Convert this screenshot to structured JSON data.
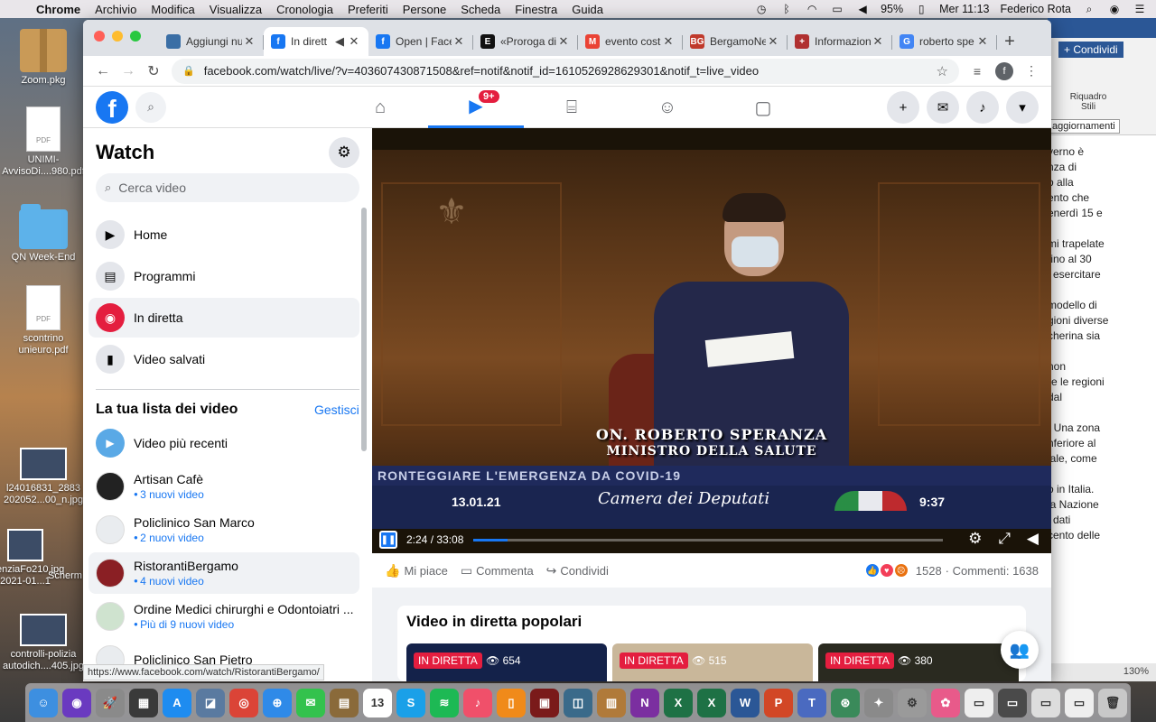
{
  "menubar": {
    "app": "Chrome",
    "items": [
      "Archivio",
      "Modifica",
      "Visualizza",
      "Cronologia",
      "Preferiti",
      "Persone",
      "Scheda",
      "Finestra",
      "Guida"
    ],
    "battery": "95%",
    "datetime": "Mer 11:13",
    "user": "Federico Rota"
  },
  "desktop": {
    "icons": [
      "Zoom.pkg",
      "UNIMI-AvvisoDi....980.pdf",
      "QN Week-End",
      "scontrino unieuro.pdf",
      "controlli-polizia autodich....405.jpg"
    ],
    "partial_labels": [
      "l24016831_2883",
      "202052...00_n.jpg",
      "enziaFo210.jpg",
      "2021-01...1",
      "Scherm"
    ]
  },
  "bg_window": {
    "share_label": "+ Condividi",
    "styles_label": "Riquadro Stili",
    "updates_label": "aggiornamenti",
    "doc_lines": [
      "verno è",
      "nza di",
      "o alla",
      "ento che",
      "enerdì 15 e",
      "",
      "mi trapelate",
      "fino al 30",
      "i esercitare",
      "",
      "modello di",
      "gioni diverse",
      "cherina sia",
      "",
      "non",
      "re le regioni",
      "dal",
      "",
      ". Una zona",
      "nferiore al",
      "iale, come",
      "",
      "o in Italia.",
      "la Nazione",
      "i dati",
      "cento delle"
    ],
    "zoom": "130%"
  },
  "browser": {
    "tabs": [
      {
        "title": "Aggiungi nu",
        "color": "#3a6ea5",
        "letter": "",
        "active": false
      },
      {
        "title": "In dirett",
        "color": "#1877f2",
        "letter": "f",
        "active": true
      },
      {
        "title": "Open | Face",
        "color": "#1877f2",
        "letter": "f",
        "active": false
      },
      {
        "title": "«Proroga di",
        "color": "#111111",
        "letter": "E",
        "active": false
      },
      {
        "title": "evento cost",
        "color": "#ea4335",
        "letter": "M",
        "active": false
      },
      {
        "title": "BergamoNe",
        "color": "#c0392b",
        "letter": "BG",
        "active": false
      },
      {
        "title": "Informazion",
        "color": "#b03030",
        "letter": "+",
        "active": false
      },
      {
        "title": "roberto spe",
        "color": "#4285f4",
        "letter": "G",
        "active": false
      }
    ],
    "url": "facebook.com/watch/live/?v=403607430871508&ref=notif&notif_id=1610526928629301&notif_t=live_video",
    "profile_letter": "f",
    "status_url": "https://www.facebook.com/watch/RistorantiBergamo/"
  },
  "fb": {
    "badge": "9+",
    "watch_title": "Watch",
    "search_placeholder": "Cerca video",
    "menu": [
      "Home",
      "Programmi",
      "In diretta",
      "Video salvati"
    ],
    "list_header": "La tua lista dei video",
    "manage": "Gestisci",
    "list": [
      {
        "name": "Video più recenti",
        "sub": null,
        "color": "#5aa9e6"
      },
      {
        "name": "Artisan Cafè",
        "sub": "3 nuovi video",
        "color": "#222222"
      },
      {
        "name": "Policlinico San Marco",
        "sub": "2 nuovi video",
        "color": "#e9ecef"
      },
      {
        "name": "RistorantiBergamo",
        "sub": "4 nuovi video",
        "color": "#8a1f24"
      },
      {
        "name": "Ordine Medici chirurghi e Odontoiatri ...",
        "sub": "Più di 9 nuovi video",
        "color": "#cfe3cf"
      },
      {
        "name": "Policlinico San Pietro",
        "sub": null,
        "color": "#e9ecef"
      }
    ],
    "video": {
      "caption_name": "ON. ROBERTO SPERANZA",
      "caption_role": "MINISTRO DELLA SALUTE",
      "ticker": "RONTEGGIARE L'EMERGENZA DA COVID-19",
      "date": "13.01.21",
      "channel": "Camera dei Deputati",
      "clock": "9:37",
      "time": "2:24 / 33:08",
      "progress": 0.0725
    },
    "actions": [
      "Mi piace",
      "Commenta",
      "Condividi"
    ],
    "reactions_count": "1528",
    "comments": "· Commenti: 1638",
    "popular_title": "Video in diretta popolari",
    "popular": [
      {
        "live": "IN DIRETTA",
        "viewers": "654",
        "color": "#14224a"
      },
      {
        "live": "IN DIRETTA",
        "viewers": "515",
        "color": "#c9b79a"
      },
      {
        "live": "IN DIRETTA",
        "viewers": "380",
        "color": "#2a2a20"
      }
    ]
  },
  "dock": {
    "apps": [
      {
        "name": "finder-icon",
        "color": "#3d8fe0",
        "glyph": "☺"
      },
      {
        "name": "siri-icon",
        "color": "#6a3ac0",
        "glyph": "◉"
      },
      {
        "name": "launchpad-icon",
        "color": "#8a8a8a",
        "glyph": "🚀"
      },
      {
        "name": "mission-control-icon",
        "color": "#3a3a3a",
        "glyph": "▦"
      },
      {
        "name": "app-store-icon",
        "color": "#1e8cf0",
        "glyph": "A"
      },
      {
        "name": "preview-icon",
        "color": "#5a7aa0",
        "glyph": "◪"
      },
      {
        "name": "chrome-icon",
        "color": "#db4437",
        "glyph": "◎"
      },
      {
        "name": "safari-icon",
        "color": "#2f8ae8",
        "glyph": "⊕"
      },
      {
        "name": "messages-icon",
        "color": "#33c24d",
        "glyph": "✉"
      },
      {
        "name": "notes-icon",
        "color": "#8a6a3a",
        "glyph": "▤"
      },
      {
        "name": "calendar-icon",
        "color": "#ffffff",
        "glyph": "13"
      },
      {
        "name": "skype-icon",
        "color": "#1aa0e8",
        "glyph": "S"
      },
      {
        "name": "spotify-icon",
        "color": "#1db954",
        "glyph": "≋"
      },
      {
        "name": "music-icon",
        "color": "#f0506a",
        "glyph": "♪"
      },
      {
        "name": "books-icon",
        "color": "#f08a1a",
        "glyph": "▯"
      },
      {
        "name": "photo-booth-icon",
        "color": "#7a1a1a",
        "glyph": "▣"
      },
      {
        "name": "image-capture-icon",
        "color": "#3a6a8a",
        "glyph": "◫"
      },
      {
        "name": "photos-folder-icon",
        "color": "#b07a3a",
        "glyph": "▥"
      },
      {
        "name": "onenote-icon",
        "color": "#7b2fa0",
        "glyph": "N"
      },
      {
        "name": "excel-icon",
        "color": "#1e7145",
        "glyph": "X"
      },
      {
        "name": "excel-icon-2",
        "color": "#1e7145",
        "glyph": "X"
      },
      {
        "name": "word-icon",
        "color": "#2b5796",
        "glyph": "W"
      },
      {
        "name": "powerpoint-icon",
        "color": "#d24726",
        "glyph": "P"
      },
      {
        "name": "teams-icon",
        "color": "#4a6ac0",
        "glyph": "T"
      },
      {
        "name": "network-icon",
        "color": "#3a8a5a",
        "glyph": "⊛"
      },
      {
        "name": "satellite-icon",
        "color": "#8a8a8a",
        "glyph": "✦"
      },
      {
        "name": "preferences-icon",
        "color": "#9a9a9a",
        "glyph": "⚙"
      },
      {
        "name": "pinwheel-icon",
        "color": "#e85a8a",
        "glyph": "✿"
      },
      {
        "name": "document-icon",
        "color": "#eeeeee",
        "glyph": "▭"
      },
      {
        "name": "screenshot-icon",
        "color": "#4a4a4a",
        "glyph": "▭"
      },
      {
        "name": "window-icon",
        "color": "#dddddd",
        "glyph": "▭"
      },
      {
        "name": "window-icon-2",
        "color": "#eeeeee",
        "glyph": "▭"
      },
      {
        "name": "trash-icon",
        "color": "#c8c8c8",
        "glyph": "🗑"
      }
    ]
  }
}
